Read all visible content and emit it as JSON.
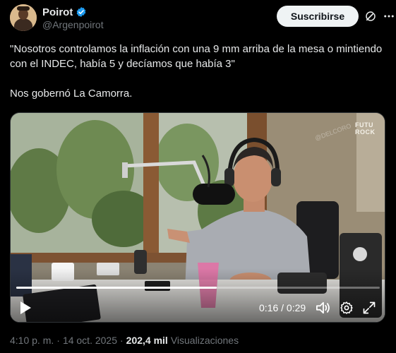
{
  "author": {
    "name": "Poirot",
    "handle": "@Argenpoirot"
  },
  "actions": {
    "subscribe_label": "Suscribirse"
  },
  "icons": {
    "verified": "verified-badge-icon",
    "grok": "grok-icon",
    "more": "more-icon",
    "play": "play-icon",
    "volume": "volume-icon",
    "settings": "gear-icon",
    "fullscreen": "expand-icon"
  },
  "colors": {
    "verified": "#1d9bf0",
    "background": "#000000",
    "text": "#e7e9ea",
    "muted": "#71767b"
  },
  "tweet": {
    "line1": "\"Nosotros controlamos la inflación con una 9 mm arriba de la mesa o mintiendo con el INDEC, había 5 y decíamos que había 3\"",
    "line2": "Nos gobernó La Camorra."
  },
  "video": {
    "brand": "FUTU ROCK",
    "watermark": "@DELCORO",
    "current_time": "0:16",
    "total_time": "0:29",
    "time_separator": " / ",
    "progress_fraction": 0.552
  },
  "meta": {
    "time": "4:10 p. m.",
    "date": "14 oct. 2025",
    "separator": "·",
    "views": "202,4 mil",
    "views_label": "Visualizaciones"
  }
}
